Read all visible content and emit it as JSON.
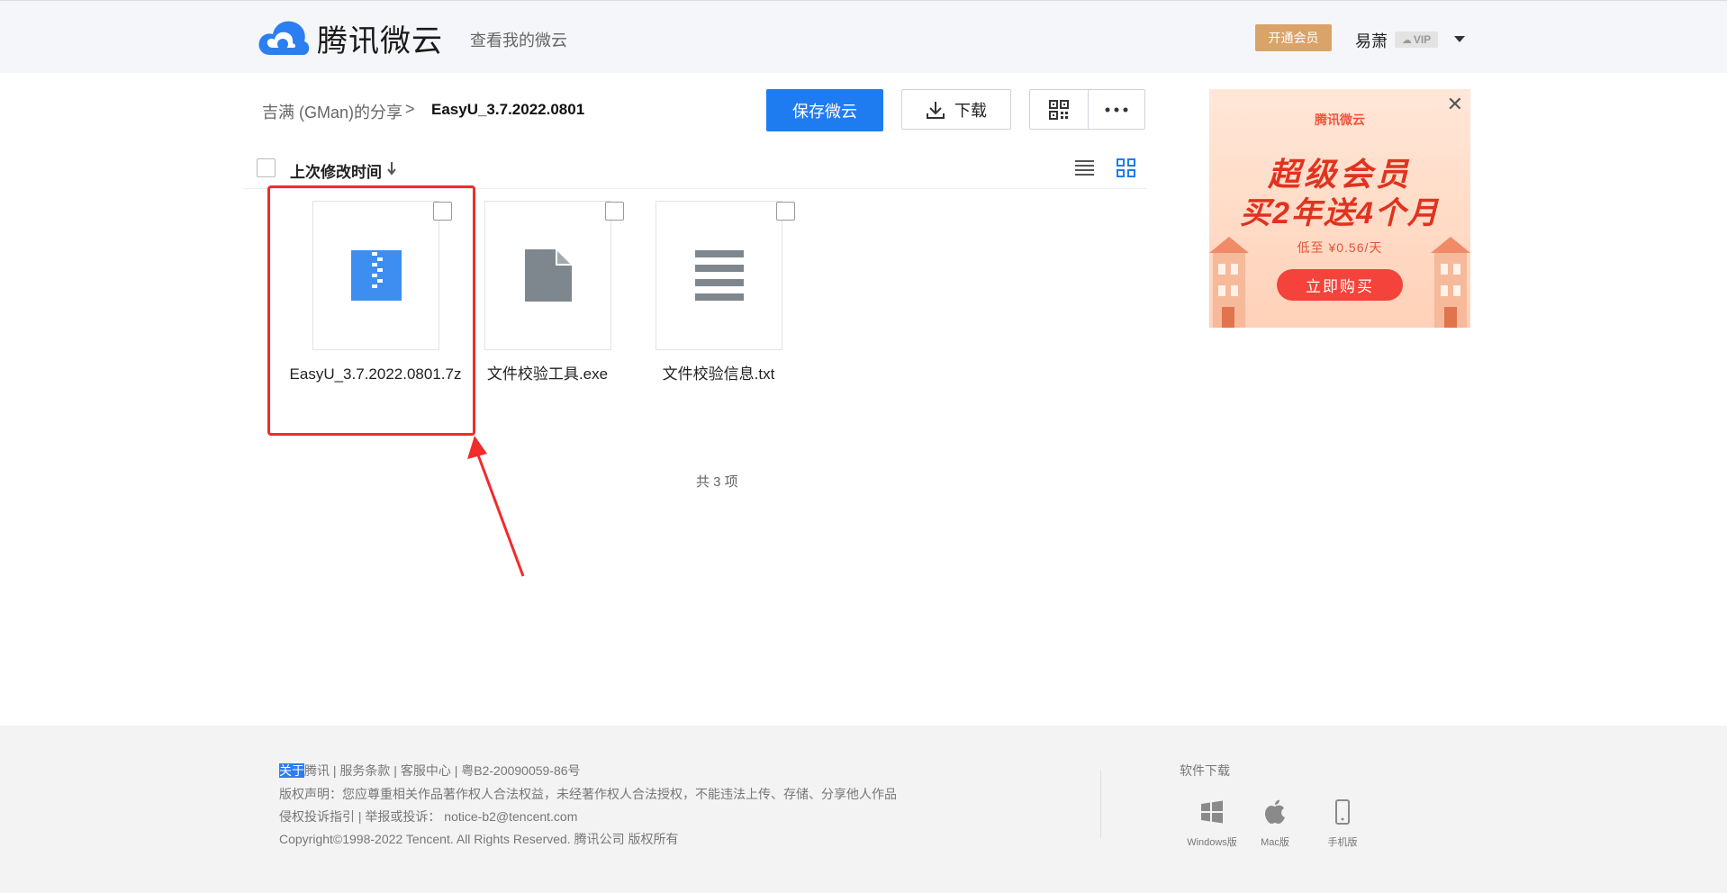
{
  "header": {
    "logo_text": "腾讯微云",
    "link_text": "查看我的微云",
    "vip_button": "开通会员",
    "username": "易萧",
    "vip_badge": "VIP"
  },
  "breadcrumb": {
    "root": "吉满 (GMan)的分享",
    "separator": ">",
    "current": "EasyU_3.7.2022.0801"
  },
  "toolbar": {
    "save_label": "保存微云",
    "download_label": "下载"
  },
  "list": {
    "sort_label": "上次修改时间",
    "files": [
      {
        "name": "EasyU_3.7.2022.0801.7z",
        "icon": "zip-file-icon"
      },
      {
        "name": "文件校验工具.exe",
        "icon": "document-file-icon"
      },
      {
        "name": "文件校验信息.txt",
        "icon": "text-file-icon"
      }
    ],
    "count_text": "共 3 项"
  },
  "ad": {
    "close": "✕",
    "logo": "腾讯微云",
    "title_line1": "超级会员",
    "title_line2": "买2年送4个月",
    "price": "低至 ¥0.56/天",
    "button": "立即购买"
  },
  "footer": {
    "line1_selected": "关于",
    "line1_rest": "腾讯 | 服务条款 | 客服中心 | 粤B2-20090059-86号",
    "line2": "版权声明：您应尊重相关作品著作权人合法权益，未经著作权人合法授权，不能违法上传、存储、分享他人作品",
    "line3": "侵权投诉指引 | 举报或投诉：  notice-b2@tencent.com",
    "line4": "Copyright©1998-2022 Tencent. All Rights Reserved. 腾讯公司 版权所有",
    "download_title": "软件下载",
    "downloads": [
      "Windows版",
      "Mac版",
      "手机版"
    ]
  },
  "colors": {
    "accent": "#1e7cf0",
    "vip_gold": "#d9a36a",
    "highlight_red": "#f22b2b"
  }
}
